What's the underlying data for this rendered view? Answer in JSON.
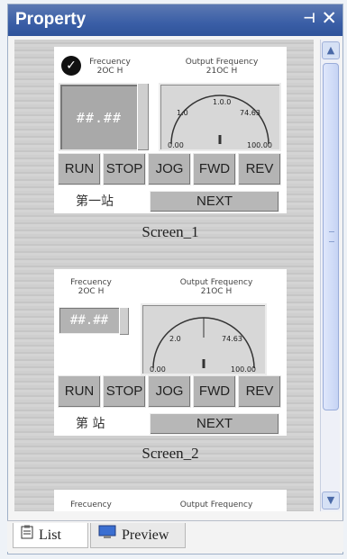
{
  "window": {
    "title": "Property",
    "pin_icon": "pin-icon",
    "close_icon": "close-icon"
  },
  "screens": [
    {
      "caption": "Screen_1",
      "freq_label": "Frecuency",
      "freq_unit": "2OC H",
      "output_label": "Output Frequency",
      "output_unit": "21OC H",
      "display_value": "##.##",
      "gauge": {
        "left": "1.0",
        "top": "1.0.0",
        "right": "74.63",
        "min": "0.00",
        "max": "100.00"
      },
      "buttons": [
        "RUN",
        "STOP",
        "JOG",
        "FWD",
        "REV"
      ],
      "station_label": "第一站",
      "next_label": "NEXT"
    },
    {
      "caption": "Screen_2",
      "freq_label": "Frecuency",
      "freq_unit": "2OC H",
      "output_label": "Output Frequency",
      "output_unit": "21OC H",
      "display_value": "##.##",
      "gauge": {
        "left": "2.0",
        "right": "74.63",
        "min": "0.00",
        "max": "100.00"
      },
      "buttons": [
        "RUN",
        "STOP",
        "JOG",
        "FWD",
        "REV"
      ],
      "station_label": "第 站",
      "next_label": "NEXT"
    },
    {
      "freq_label": "Frecuency",
      "output_label": "Output Frequency"
    }
  ],
  "tabs": [
    {
      "label": "List",
      "icon": "clipboard-icon",
      "active": true
    },
    {
      "label": "Preview",
      "icon": "monitor-icon",
      "active": false
    }
  ],
  "colors": {
    "titlebar": "#3a5ea6",
    "scroll_thumb": "#c6d4f4",
    "button_face": "#b4b4b4"
  }
}
